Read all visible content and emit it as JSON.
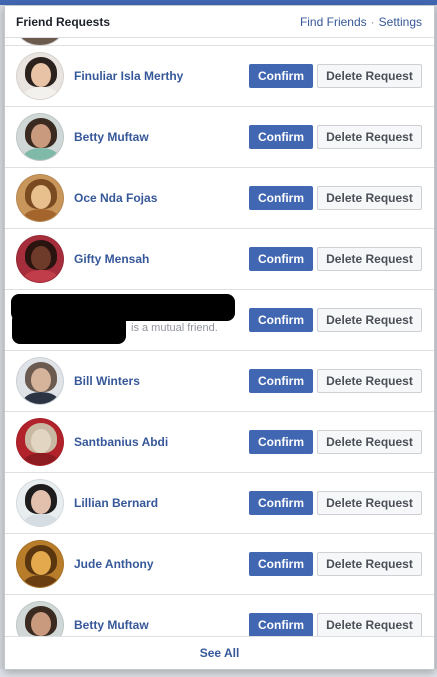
{
  "header": {
    "title": "Friend Requests",
    "find_friends": "Find Friends",
    "separator": "·",
    "settings": "Settings"
  },
  "buttons": {
    "confirm": "Confirm",
    "delete": "Delete Request"
  },
  "requests": [
    {
      "name": "Finuliar Isla Merthy",
      "avatar": {
        "bg": "#e9e4df",
        "hair": "#2b221d",
        "face": "#e8c3a6",
        "body": "#f3f1ee"
      }
    },
    {
      "name": "Betty Muftaw",
      "avatar": {
        "bg": "#cfd8d6",
        "hair": "#3b2a20",
        "face": "#c99a7d",
        "body": "#7fb9a8"
      }
    },
    {
      "name": "Oce Nda Fojas",
      "avatar": {
        "bg": "#c8955a",
        "hair": "#7a4a21",
        "face": "#e7c08e",
        "body": "#a4652c"
      }
    },
    {
      "name": "Gifty Mensah",
      "avatar": {
        "bg": "#a62e3c",
        "hair": "#2a1410",
        "face": "#6e3a2a",
        "body": "#c23d4a"
      }
    },
    {
      "name": "",
      "mutual_text": "is a mutual friend.",
      "redacted": true
    },
    {
      "name": "Bill Winters",
      "avatar": {
        "bg": "#dfe3e8",
        "hair": "#6b5a50",
        "face": "#d6b39b",
        "body": "#2c3444"
      }
    },
    {
      "name": "Santbanius Abdi",
      "avatar": {
        "bg": "#b2222a",
        "hair": "#c9b9a2",
        "face": "#e2d6c3",
        "body": "#8c1b21"
      }
    },
    {
      "name": "Lillian Bernard",
      "avatar": {
        "bg": "#e8edf0",
        "hair": "#1e1c1c",
        "face": "#e2c0ad",
        "body": "#d5dde3"
      }
    },
    {
      "name": "Jude Anthony",
      "avatar": {
        "bg": "#b87d2a",
        "hair": "#5a3610",
        "face": "#e3a94c",
        "body": "#6b3e12"
      }
    },
    {
      "name": "Betty Muftaw",
      "avatar": {
        "bg": "#cfd8d6",
        "hair": "#3b2a20",
        "face": "#c99a7d",
        "body": "#7fb9a8"
      }
    }
  ],
  "footer": {
    "see_all": "See All"
  },
  "colors": {
    "accent": "#4267b2",
    "link": "#365899"
  }
}
